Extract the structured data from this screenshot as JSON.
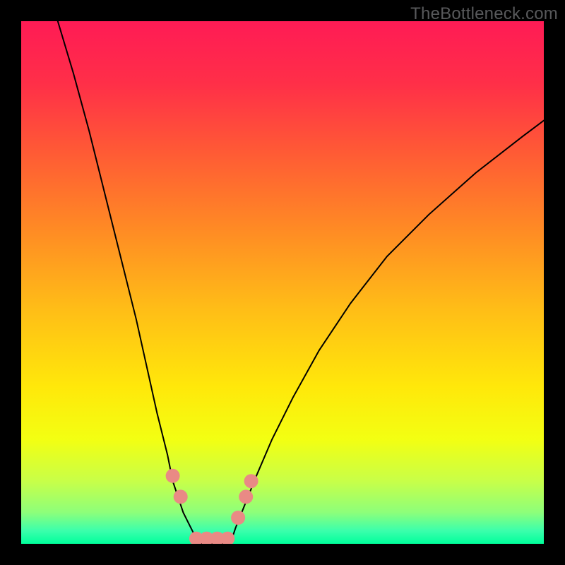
{
  "watermark": "TheBottleneck.com",
  "chart_data": {
    "type": "line",
    "title": "",
    "xlabel": "",
    "ylabel": "",
    "xlim": [
      0,
      100
    ],
    "ylim": [
      0,
      100
    ],
    "grid": false,
    "background_gradient": {
      "stops": [
        {
          "pos": 0.0,
          "color": "#ff1b55"
        },
        {
          "pos": 0.12,
          "color": "#ff2f48"
        },
        {
          "pos": 0.25,
          "color": "#ff5a35"
        },
        {
          "pos": 0.4,
          "color": "#ff8b24"
        },
        {
          "pos": 0.55,
          "color": "#ffbd17"
        },
        {
          "pos": 0.7,
          "color": "#ffe80a"
        },
        {
          "pos": 0.8,
          "color": "#f3ff12"
        },
        {
          "pos": 0.88,
          "color": "#c8ff48"
        },
        {
          "pos": 0.94,
          "color": "#8dff7a"
        },
        {
          "pos": 0.975,
          "color": "#3bffac"
        },
        {
          "pos": 1.0,
          "color": "#00ff9b"
        }
      ]
    },
    "series": [
      {
        "name": "left-curve",
        "x": [
          7,
          10,
          13,
          16,
          19,
          22,
          24,
          26,
          28,
          29,
          30,
          31,
          32,
          33,
          34
        ],
        "y": [
          100,
          90,
          79,
          67,
          55,
          43,
          34,
          25,
          17,
          12,
          9,
          6,
          4,
          2,
          0
        ]
      },
      {
        "name": "right-curve",
        "x": [
          40,
          41,
          43,
          45,
          48,
          52,
          57,
          63,
          70,
          78,
          87,
          96,
          100
        ],
        "y": [
          0,
          3,
          8,
          13,
          20,
          28,
          37,
          46,
          55,
          63,
          71,
          78,
          81
        ]
      },
      {
        "name": "floor",
        "x": [
          34,
          36,
          38,
          40
        ],
        "y": [
          0,
          0,
          0,
          0
        ]
      }
    ],
    "markers": [
      {
        "name": "left-marker-1",
        "x": 29.0,
        "y": 13.0
      },
      {
        "name": "left-marker-2",
        "x": 30.5,
        "y": 9.0
      },
      {
        "name": "floor-marker-1",
        "x": 33.5,
        "y": 1.0
      },
      {
        "name": "floor-marker-2",
        "x": 35.5,
        "y": 1.0
      },
      {
        "name": "floor-marker-3",
        "x": 37.5,
        "y": 1.0
      },
      {
        "name": "floor-marker-4",
        "x": 39.5,
        "y": 1.0
      },
      {
        "name": "right-marker-1",
        "x": 41.5,
        "y": 5.0
      },
      {
        "name": "right-marker-2",
        "x": 43.0,
        "y": 9.0
      },
      {
        "name": "right-marker-3",
        "x": 44.0,
        "y": 12.0
      }
    ],
    "marker_style": {
      "radius_px": 10,
      "fill": "#e98a85"
    }
  }
}
